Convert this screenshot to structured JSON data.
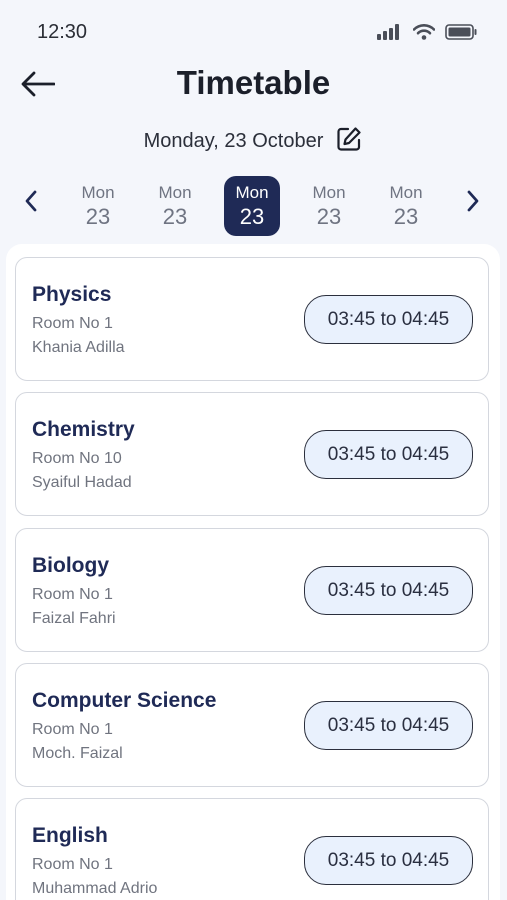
{
  "status_bar": {
    "time": "12:30"
  },
  "header": {
    "title": "Timetable"
  },
  "date": {
    "label": "Monday, 23 October"
  },
  "day_strip": [
    {
      "name": "Mon",
      "num": "23",
      "active": false
    },
    {
      "name": "Mon",
      "num": "23",
      "active": false
    },
    {
      "name": "Mon",
      "num": "23",
      "active": true
    },
    {
      "name": "Mon",
      "num": "23",
      "active": false
    },
    {
      "name": "Mon",
      "num": "23",
      "active": false
    }
  ],
  "classes": [
    {
      "subject": "Physics",
      "room": "Room No 1",
      "teacher": "Khania Adilla",
      "time": "03:45 to 04:45"
    },
    {
      "subject": "Chemistry",
      "room": "Room No 10",
      "teacher": "Syaiful Hadad",
      "time": "03:45 to 04:45"
    },
    {
      "subject": "Biology",
      "room": "Room No 1",
      "teacher": "Faizal Fahri",
      "time": "03:45 to 04:45"
    },
    {
      "subject": "Computer Science",
      "room": "Room No 1",
      "teacher": "Moch. Faizal",
      "time": "03:45 to 04:45"
    },
    {
      "subject": "English",
      "room": "Room No 1",
      "teacher": "Muhammad Adrio",
      "time": "03:45 to 04:45"
    }
  ],
  "colors": {
    "accent": "#1f2a56",
    "pill_bg": "#e9f1fd",
    "page_bg": "#f4f6fb",
    "card_border": "#d4d7de"
  },
  "icons": [
    "signal-icon",
    "wifi-icon",
    "battery-icon",
    "back-arrow-icon",
    "edit-icon",
    "chevron-left-icon",
    "chevron-right-icon"
  ]
}
